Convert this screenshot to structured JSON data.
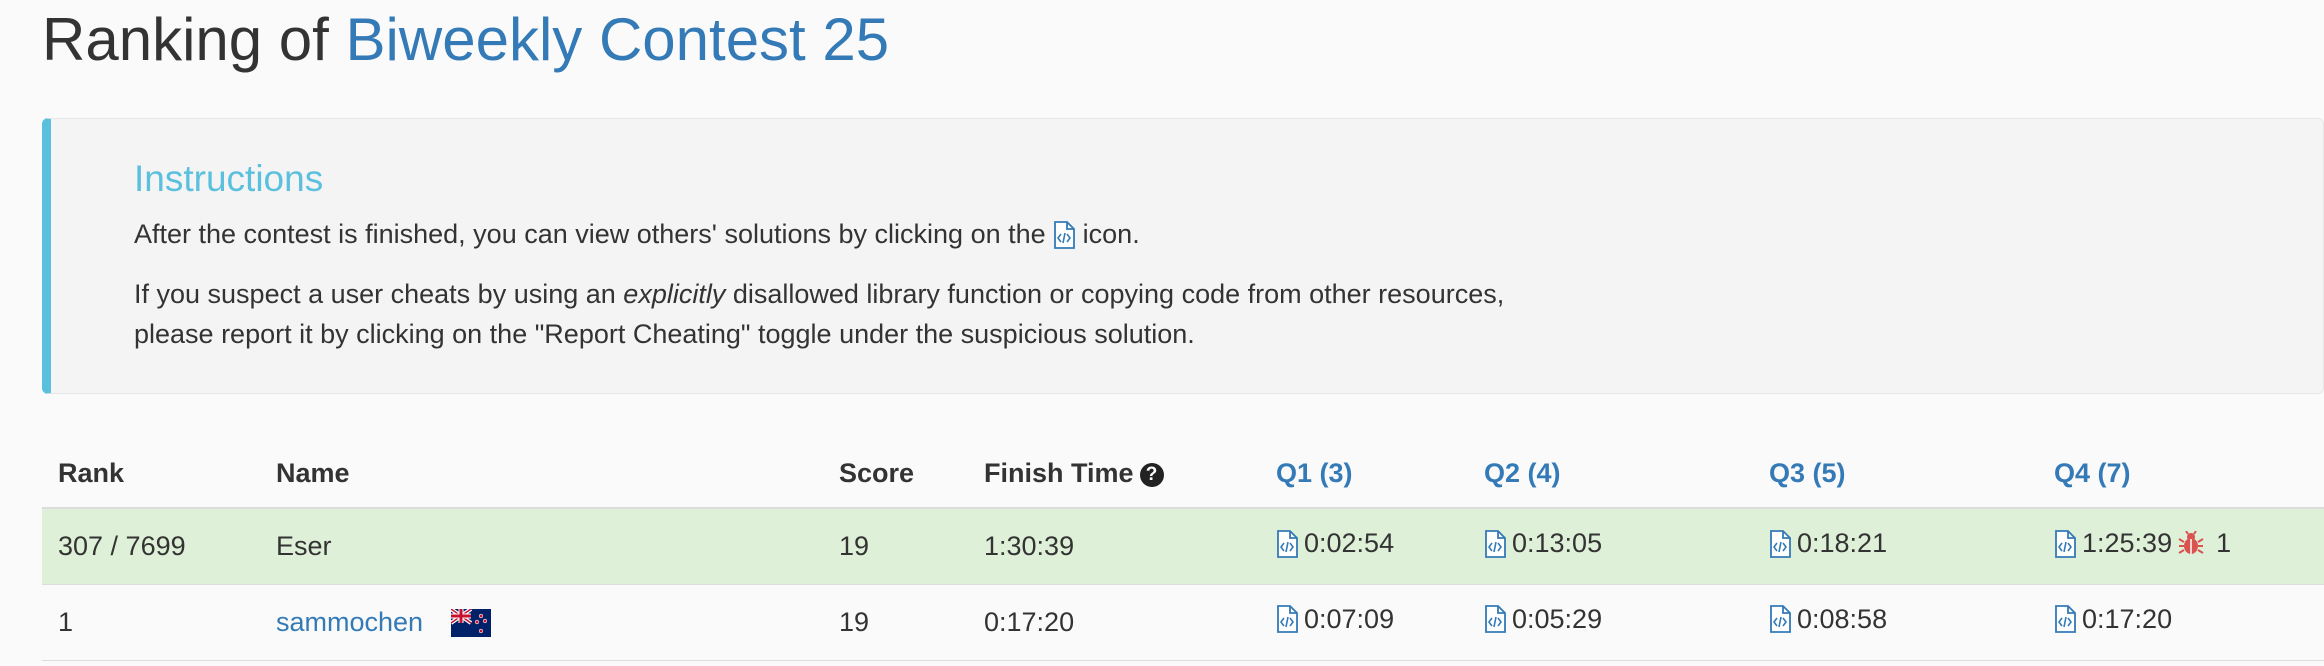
{
  "header": {
    "title_prefix": "Ranking of",
    "contest_name": "Biweekly Contest 25"
  },
  "instructions": {
    "heading": "Instructions",
    "line1_before_icon": "After the contest is finished, you can view others' solutions by clicking on the",
    "line1_after_icon": "icon.",
    "line2_before_em": "If you suspect a user cheats by using an",
    "line2_em": "explicitly",
    "line2_after_em": "disallowed library function or copying code from other resources,",
    "line3": "please report it by clicking on the \"Report Cheating\" toggle under the suspicious solution."
  },
  "table": {
    "headers": {
      "rank": "Rank",
      "name": "Name",
      "score": "Score",
      "finish_time": "Finish Time",
      "q1": "Q1 (3)",
      "q2": "Q2 (4)",
      "q3": "Q3 (5)",
      "q4": "Q4 (7)"
    },
    "rows": [
      {
        "rank": "307 / 7699",
        "name": "Eser",
        "score": "19",
        "finish_time": "1:30:39",
        "q1": "0:02:54",
        "q2": "0:13:05",
        "q3": "0:18:21",
        "q4": "1:25:39",
        "q4_bugs": "1",
        "highlighted": true
      },
      {
        "rank": "1",
        "name": "sammochen",
        "score": "19",
        "finish_time": "0:17:20",
        "q1": "0:07:09",
        "q2": "0:05:29",
        "q3": "0:08:58",
        "q4": "0:17:20",
        "flag": "new-zealand-flag-icon"
      }
    ]
  },
  "colors": {
    "link": "#337ab7",
    "info": "#5bc0de",
    "highlight_row": "#dff0d8",
    "bug": "#d9534f"
  }
}
